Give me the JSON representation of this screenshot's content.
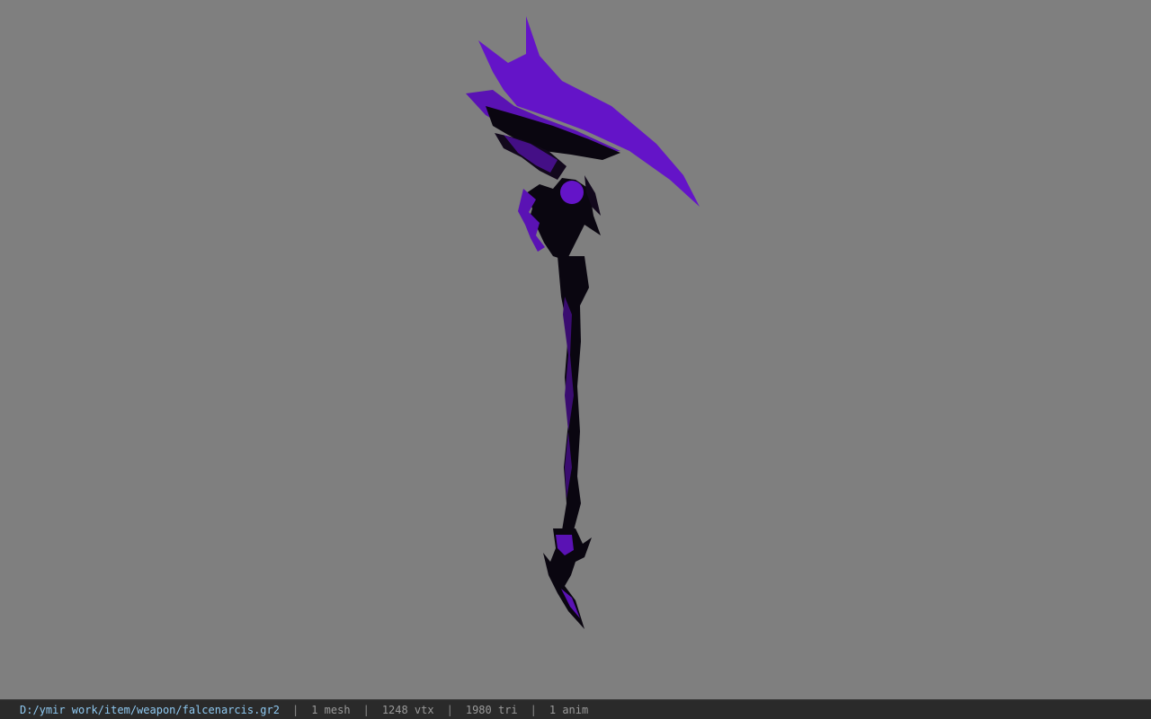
{
  "viewer": {
    "background_color": "#7f7f7f",
    "model": {
      "icon": "scythe-model",
      "blade_color": "#6414c8",
      "dark_color": "#0a0610"
    }
  },
  "statusbar": {
    "file_path": "D:/ymir work/item/weapon/falcenarcis.gr2",
    "separator": "|",
    "mesh": "1 mesh",
    "vertices": "1248 vtx",
    "triangles": "1980 tri",
    "animations": "1 anim"
  }
}
